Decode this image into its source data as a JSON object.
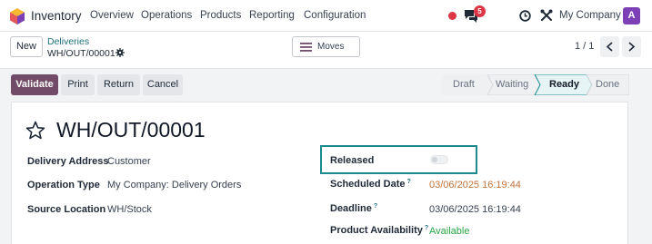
{
  "navbar": {
    "app_name": "Inventory",
    "menu": [
      "Overview",
      "Operations",
      "Products",
      "Reporting",
      "Configuration"
    ],
    "chat_badge": "5",
    "company": "My Company",
    "avatar": "A"
  },
  "control": {
    "new_label": "New",
    "breadcrumb_parent": "Deliveries",
    "breadcrumb_current": "WH/OUT/00001",
    "moves_label": "Moves",
    "pager": "1 / 1"
  },
  "actions": {
    "validate": "Validate",
    "print": "Print",
    "return": "Return",
    "cancel": "Cancel"
  },
  "statusbar": {
    "stages": [
      "Draft",
      "Waiting",
      "Ready",
      "Done"
    ],
    "active": "Ready"
  },
  "record": {
    "title": "WH/OUT/00001",
    "left_fields": [
      {
        "label": "Delivery Address",
        "value": "Customer"
      },
      {
        "label": "Operation Type",
        "value": "My Company: Delivery Orders"
      },
      {
        "label": "Source Location",
        "value": "WH/Stock"
      }
    ],
    "released_label": "Released",
    "released_value": false,
    "right_fields": [
      {
        "label": "Scheduled Date",
        "value": "03/06/2025 16:19:44",
        "help": "?"
      },
      {
        "label": "Deadline",
        "value": "03/06/2025 16:19:44",
        "help": "?"
      },
      {
        "label": "Product Availability",
        "value": "Available",
        "help": "?"
      }
    ]
  },
  "colors": {
    "brand": "#714b67",
    "link": "#1f6f78",
    "date_warning": "#c0733a",
    "available": "#28a745",
    "highlight_border": "#1d8a8f"
  }
}
